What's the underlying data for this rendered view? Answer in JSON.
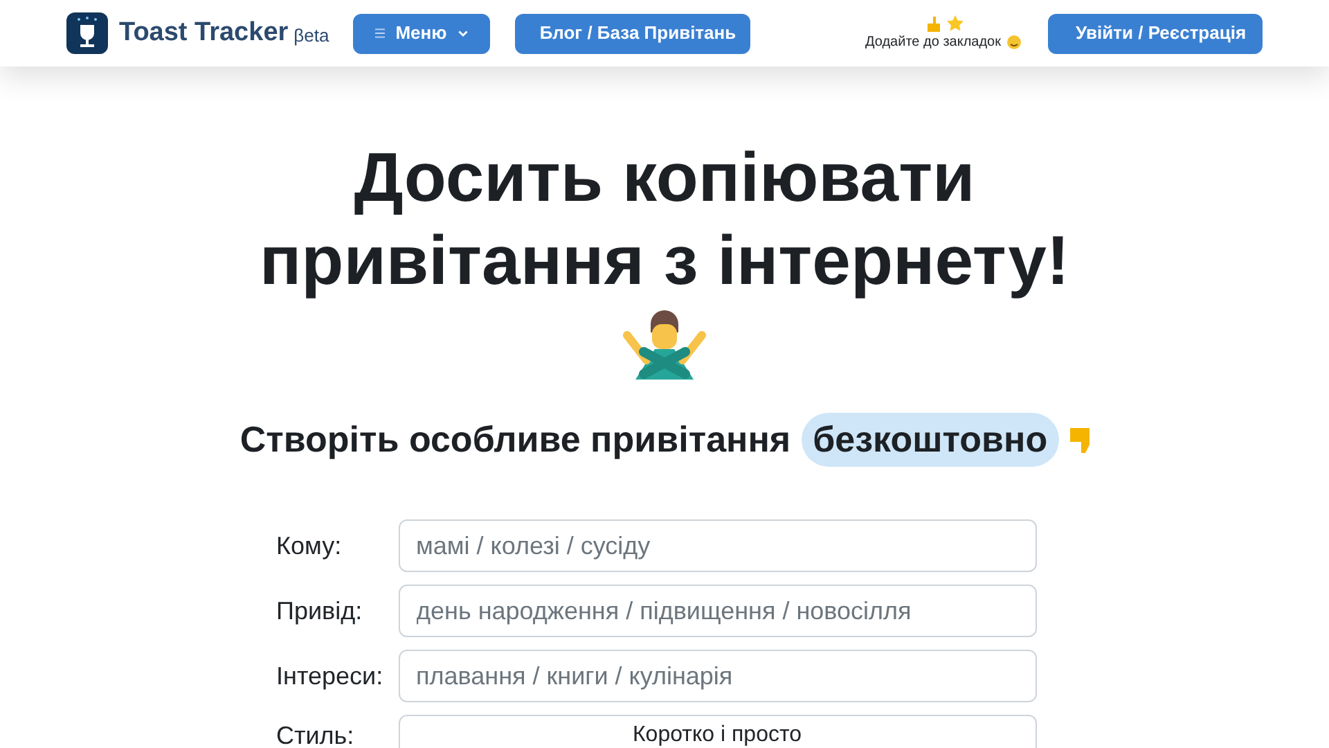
{
  "header": {
    "brand": "Toast Tracker",
    "badge": "βeta",
    "menu_button": "Меню",
    "blog_button": "Блог / База Привітань",
    "bookmark_hint": "Додайте до закладок",
    "login_button": "Увійти / Реєстрація"
  },
  "hero": {
    "title_lines": [
      "Досить копіювати",
      "привітання з інтернету!"
    ],
    "subtitle": "Створіть особливе привітання",
    "subtitle_highlight": "безкоштовно"
  },
  "form": {
    "fields": [
      {
        "kind": "text",
        "label": "Кому:",
        "placeholder": "мамі / колезі / сусіду"
      },
      {
        "kind": "text",
        "label": "Привід:",
        "placeholder": "день народження / підвищення / новосілля"
      },
      {
        "kind": "text",
        "label": "Інтереси:",
        "placeholder": "плавання / книги / кулінарія"
      },
      {
        "kind": "select",
        "label": "Стиль:",
        "value": "Коротко і просто"
      }
    ]
  }
}
